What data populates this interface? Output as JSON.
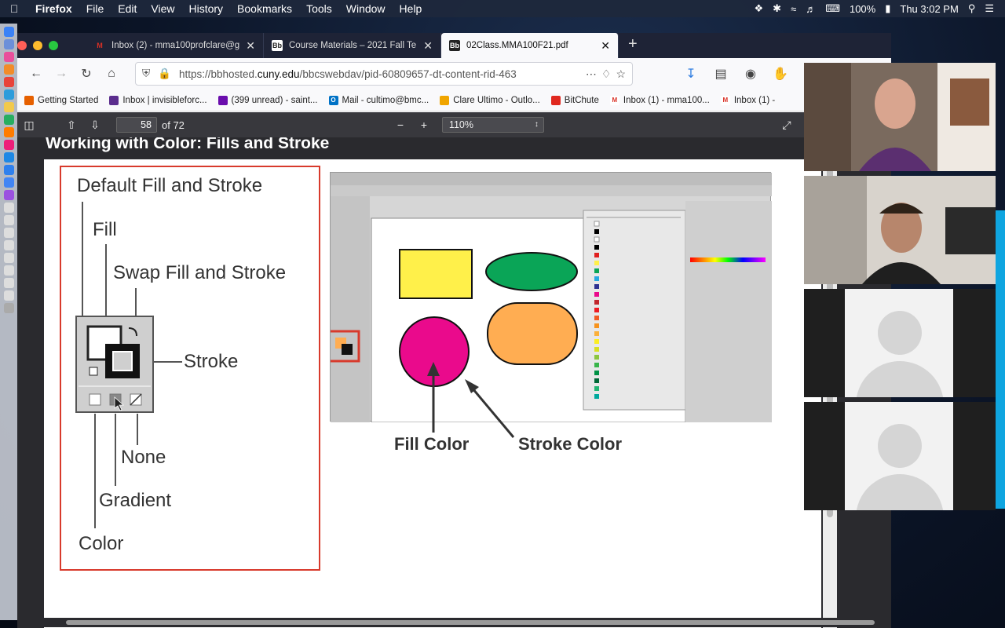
{
  "menubar": {
    "app": "Firefox",
    "items": [
      "File",
      "Edit",
      "View",
      "History",
      "Bookmarks",
      "Tools",
      "Window",
      "Help"
    ],
    "battery": "100%",
    "clock": "Thu 3:02 PM"
  },
  "tabs": [
    {
      "label": "Inbox (2) - mma100profclare@g",
      "favicon": "gmail-icon",
      "color": "#d93025"
    },
    {
      "label": "Course Materials – 2021 Fall Te",
      "favicon": "bb-icon",
      "color": "#222"
    },
    {
      "label": "02Class.MMA100F21.pdf",
      "favicon": "bb-icon",
      "color": "#222"
    }
  ],
  "urlbar": {
    "prefix": "https://bbhosted.",
    "domain": "cuny.edu",
    "rest": "/bbcswebdav/pid-60809657-dt-content-rid-463"
  },
  "bookmarks": [
    {
      "label": "Getting Started",
      "color": "#e66000"
    },
    {
      "label": "Inbox | invisibleforc...",
      "color": "#5b2d8e"
    },
    {
      "label": "(399 unread) - saint...",
      "color": "#6a0dad"
    },
    {
      "label": "Mail - cultimo@bmc...",
      "color": "#0072c6"
    },
    {
      "label": "Clare Ultimo - Outlo...",
      "color": "#f0a500"
    },
    {
      "label": "BitChute",
      "color": "#e0281f"
    },
    {
      "label": "Inbox (1) - mma100...",
      "color": "#d93025"
    },
    {
      "label": "Inbox (1) -",
      "color": "#d93025"
    }
  ],
  "pdf": {
    "page_number": "58",
    "page_total": "of 72",
    "zoom": "110%",
    "heading": "Working with Color: Fills and Stroke"
  },
  "diagram": {
    "default_fill_stroke": "Default Fill and Stroke",
    "fill": "Fill",
    "swap": "Swap Fill and Stroke",
    "stroke": "Stroke",
    "none": "None",
    "gradient": "Gradient",
    "color": "Color",
    "fill_color": "Fill Color",
    "stroke_color": "Stroke Color",
    "shape_colors": {
      "yellow": "#fff04a",
      "green": "#0aa557",
      "magenta": "#ea0a8c",
      "orange": "#ffad52"
    },
    "accent": "#d83a2c"
  }
}
